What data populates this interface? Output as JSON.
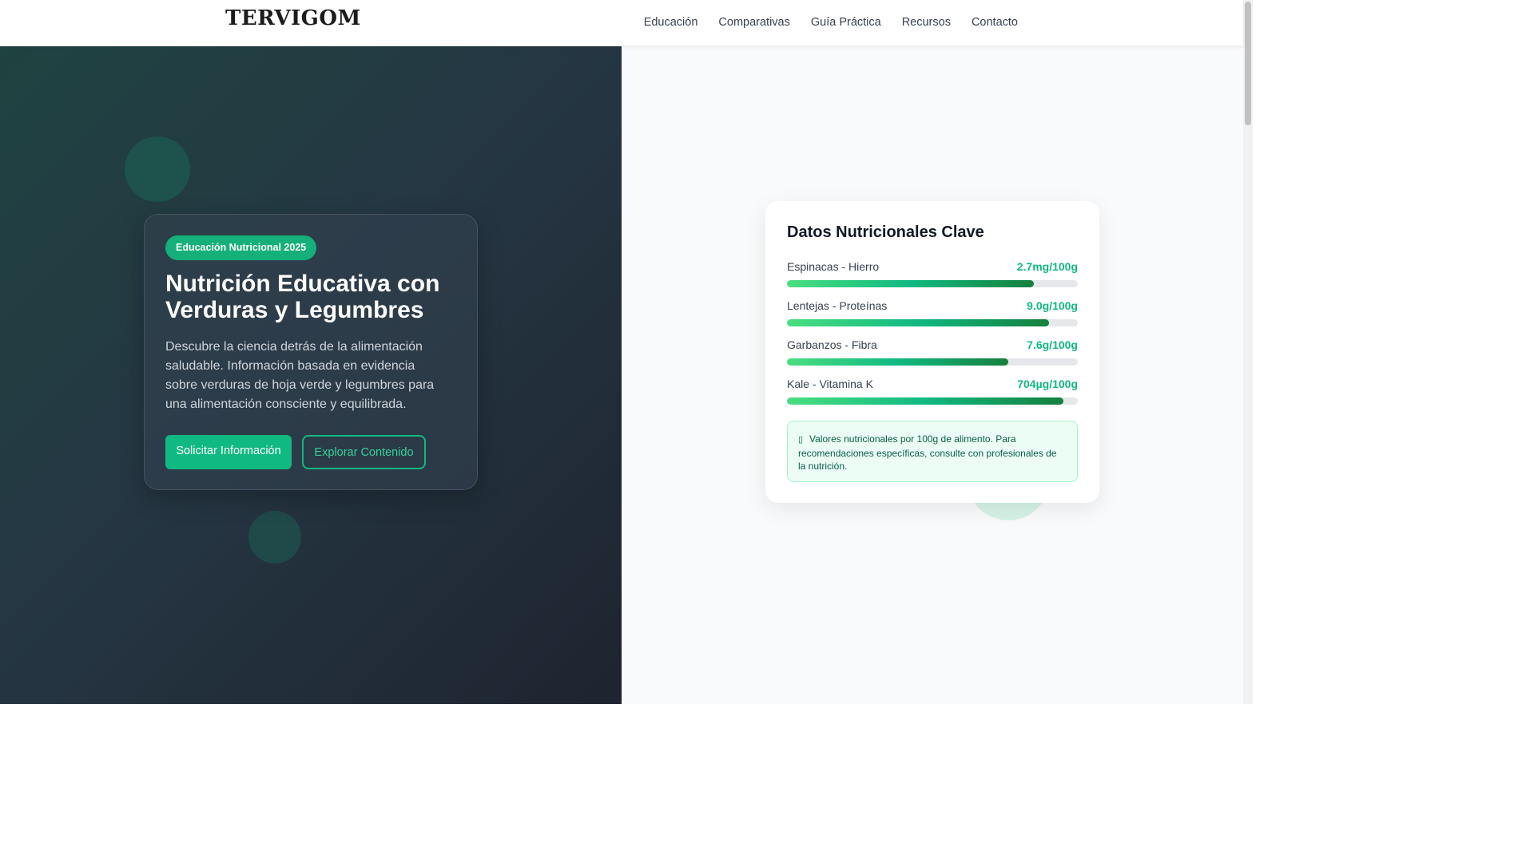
{
  "brand": {
    "logo": "TERVIGOM"
  },
  "nav": {
    "items": [
      "Educación",
      "Comparativas",
      "Guía Práctica",
      "Recursos",
      "Contacto"
    ]
  },
  "hero": {
    "badge": "Educación Nutricional 2025",
    "title": "Nutrición Educativa con Verduras y Legumbres",
    "description": "Descubre la ciencia detrás de la alimentación saludable. Información basada en evidencia sobre verduras de hoja verde y legumbres para una alimentación consciente y equilibrada.",
    "primary_button": "Solicitar Información",
    "secondary_button": "Explorar Contenido"
  },
  "nutrition": {
    "title": "Datos Nutricionales Clave",
    "items": [
      {
        "label": "Espinacas - Hierro",
        "value": "2.7mg/100g",
        "fill_percent": 85
      },
      {
        "label": "Lentejas - Proteínas",
        "value": "9.0g/100g",
        "fill_percent": 90
      },
      {
        "label": "Garbanzos - Fibra",
        "value": "7.6g/100g",
        "fill_percent": 76
      },
      {
        "label": "Kale - Vitamina K",
        "value": "704µg/100g",
        "fill_percent": 95
      }
    ],
    "note_icon": "info-icon",
    "note": "Valores nutricionales por 100g de alimento. Para recomendaciones específicas, consulte con profesionales de la nutrición."
  },
  "colors": {
    "accent": "#10b981",
    "dark_bg": "#253743",
    "note_bg": "#ecfdf5"
  }
}
